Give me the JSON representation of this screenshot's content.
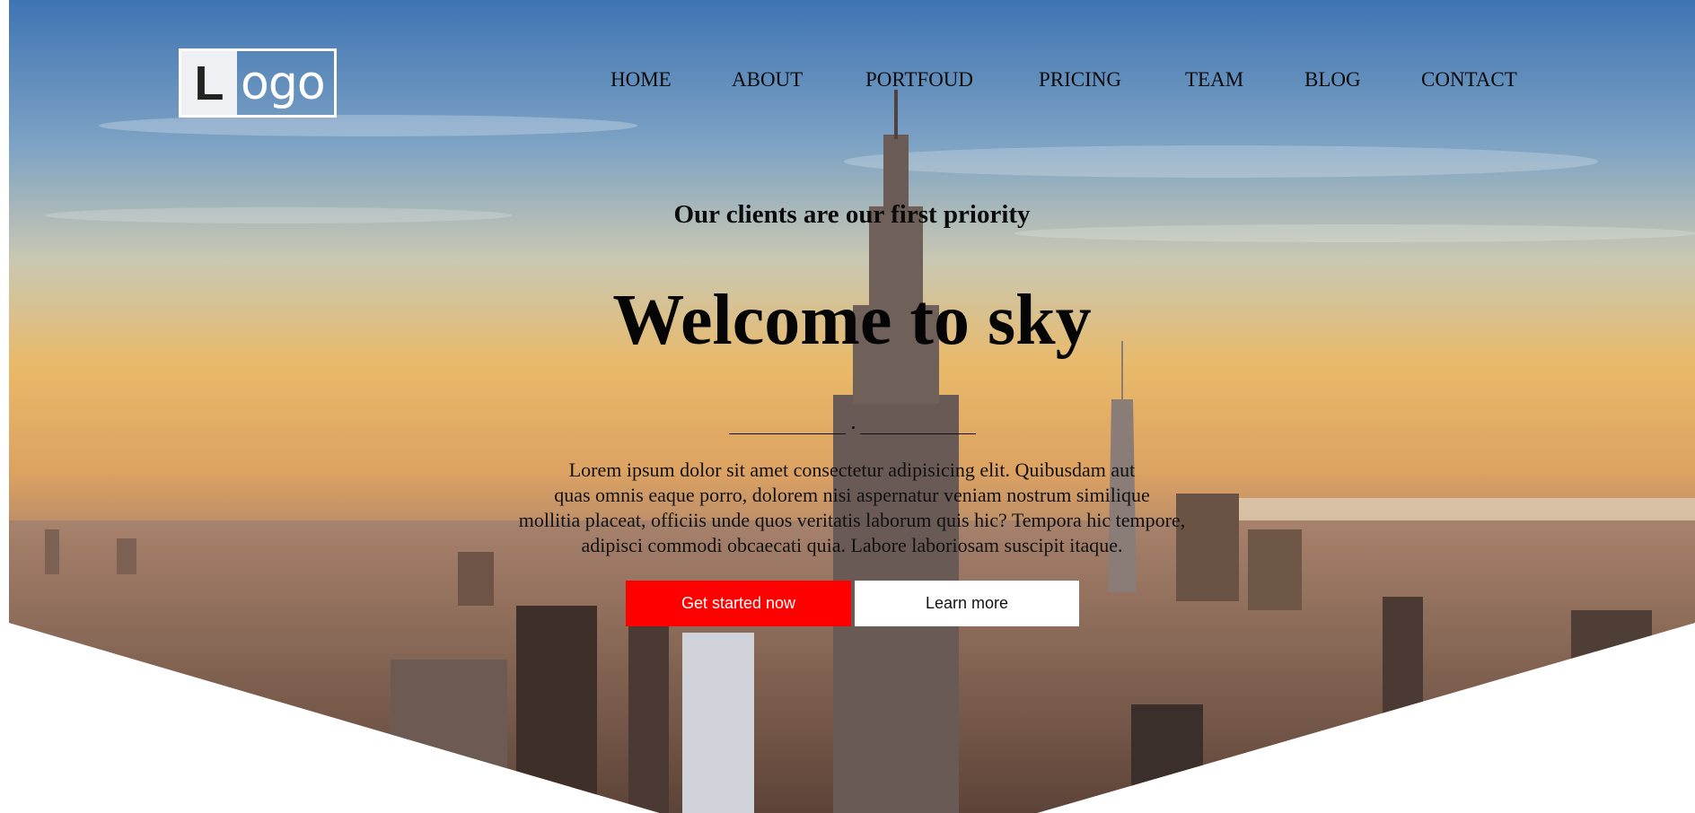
{
  "logo": {
    "letter": "L",
    "rest": "ogo"
  },
  "nav": {
    "items": [
      "HOME",
      "ABOUT",
      "PORTFOUD",
      "PRICING",
      "TEAM",
      "BLOG",
      "CONTACT"
    ]
  },
  "hero": {
    "subtitle": "Our clients are our first priority",
    "title": "Welcome to sky",
    "description_lines": [
      "Lorem ipsum dolor sit amet consectetur adipisicing elit. Quibusdam aut",
      "quas omnis eaque porro, dolorem nisi aspernatur veniam nostrum similique",
      "mollitia placeat, officiis unde quos veritatis laborum quis hic? Tempora hic tempore,",
      "adipisci commodi obcaecati quia. Labore laboriosam suscipit itaque."
    ],
    "primary_button": "Get started now",
    "secondary_button": "Learn more"
  },
  "colors": {
    "primary_button_bg": "#ff0000",
    "secondary_button_bg": "#ffffff",
    "sky_top": "#4a7fb8",
    "sky_horizon": "#e8b46a"
  }
}
